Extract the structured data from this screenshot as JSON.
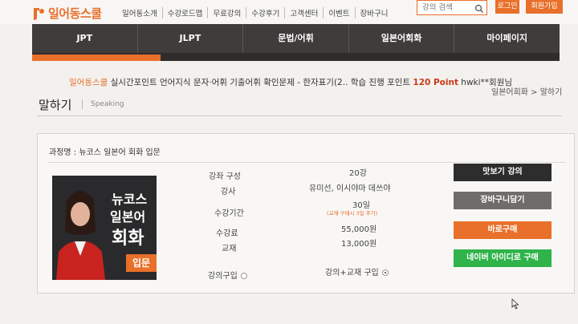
{
  "header": {
    "logo_text": "일어동스쿨",
    "nav": [
      "일어동소개",
      "수강로드맵",
      "무료강의",
      "수강후기",
      "고객센터",
      "이벤트",
      "장바구니"
    ],
    "search_placeholder": "강의 검색",
    "login_label": "로그인",
    "join_label": "회원가입"
  },
  "main_nav": {
    "tabs": [
      "JPT",
      "JLPT",
      "문법/어휘",
      "일본어회화",
      "마이페이지"
    ]
  },
  "ticker": {
    "brand": "일어동스쿨",
    "message": " 실시간포인트 언어지식 문자·어휘 기출어휘 확인문제 - 한자표기(2.. 학습 진행 포인트 ",
    "points": "120 Point",
    "user": " hwki**회원님"
  },
  "breadcrumb": "일본어회화 > 말하기",
  "page": {
    "title": "말하기",
    "subtitle": "Speaking"
  },
  "course": {
    "name": "과정명 : 뉴코스 일본어 회화 입문",
    "thumb": {
      "line1": "뉴코스",
      "line2": "일본어",
      "line3": "회화",
      "badge": "입문"
    },
    "rows": [
      {
        "label": "강좌 구성",
        "value": "20강"
      },
      {
        "label": "강사",
        "value": "유미선, 이시야마 데쓰야"
      },
      {
        "label": "수강기간",
        "value": "30일"
      },
      {
        "label": "수강료",
        "value": "55,000원"
      },
      {
        "label": "교재",
        "value": "13,000원"
      }
    ],
    "period_note": "(교재 구매시 3일 추가)",
    "option_lecture": "강의구입",
    "option_bundle": "강의+교재 구입"
  },
  "actions": {
    "preview": "맛보기 강의",
    "cart": "장바구니담기",
    "buy": "바로구매",
    "naver": "네이버 아이디로 구매"
  },
  "colors": {
    "brand": "#e9702a",
    "nav_bg": "#3f3c3b",
    "naver": "#2fb34a"
  }
}
